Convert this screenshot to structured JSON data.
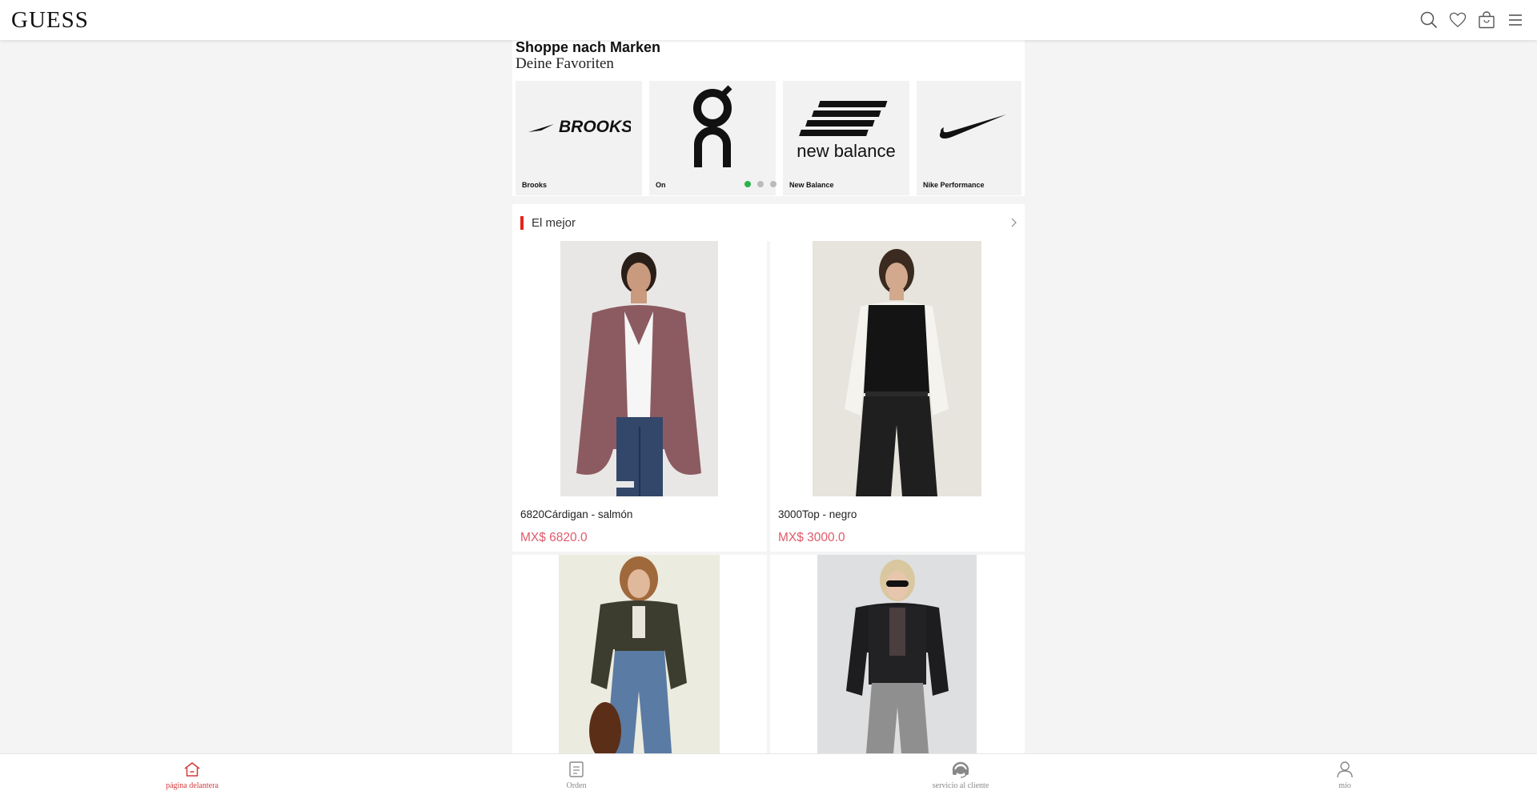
{
  "header": {
    "logo": "GUESS",
    "icons": [
      "search-icon",
      "heart-icon",
      "bag-icon",
      "menu-icon"
    ]
  },
  "brands": {
    "title": "Shoppe nach Marken",
    "subtitle": "Deine Favoriten",
    "items": [
      {
        "name": "Brooks",
        "logo_text": "BROOKS"
      },
      {
        "name": "On",
        "logo_text": ""
      },
      {
        "name": "New Balance",
        "logo_text": "new balance"
      },
      {
        "name": "Nike Performance",
        "logo_text": ""
      }
    ],
    "carousel_pages": 3,
    "carousel_active": 1
  },
  "best": {
    "title": "El mejor"
  },
  "products": [
    {
      "name": "6820Cárdigan - salmón",
      "price": "MX$ 6820.0"
    },
    {
      "name": "3000Top - negro",
      "price": "MX$ 3000.0"
    },
    {
      "name": "",
      "price": ""
    },
    {
      "name": "",
      "price": ""
    }
  ],
  "bottom_nav": [
    {
      "label": "página delantera",
      "icon": "home-icon",
      "active": true
    },
    {
      "label": "Orden",
      "icon": "order-icon",
      "active": false
    },
    {
      "label": "servicio al cliente",
      "icon": "headset-icon",
      "active": false
    },
    {
      "label": "mío",
      "icon": "user-icon",
      "active": false
    }
  ],
  "colors": {
    "accent_red": "#e5241b",
    "price_pink": "#e05a6a",
    "carousel_active": "#2bb24c"
  }
}
